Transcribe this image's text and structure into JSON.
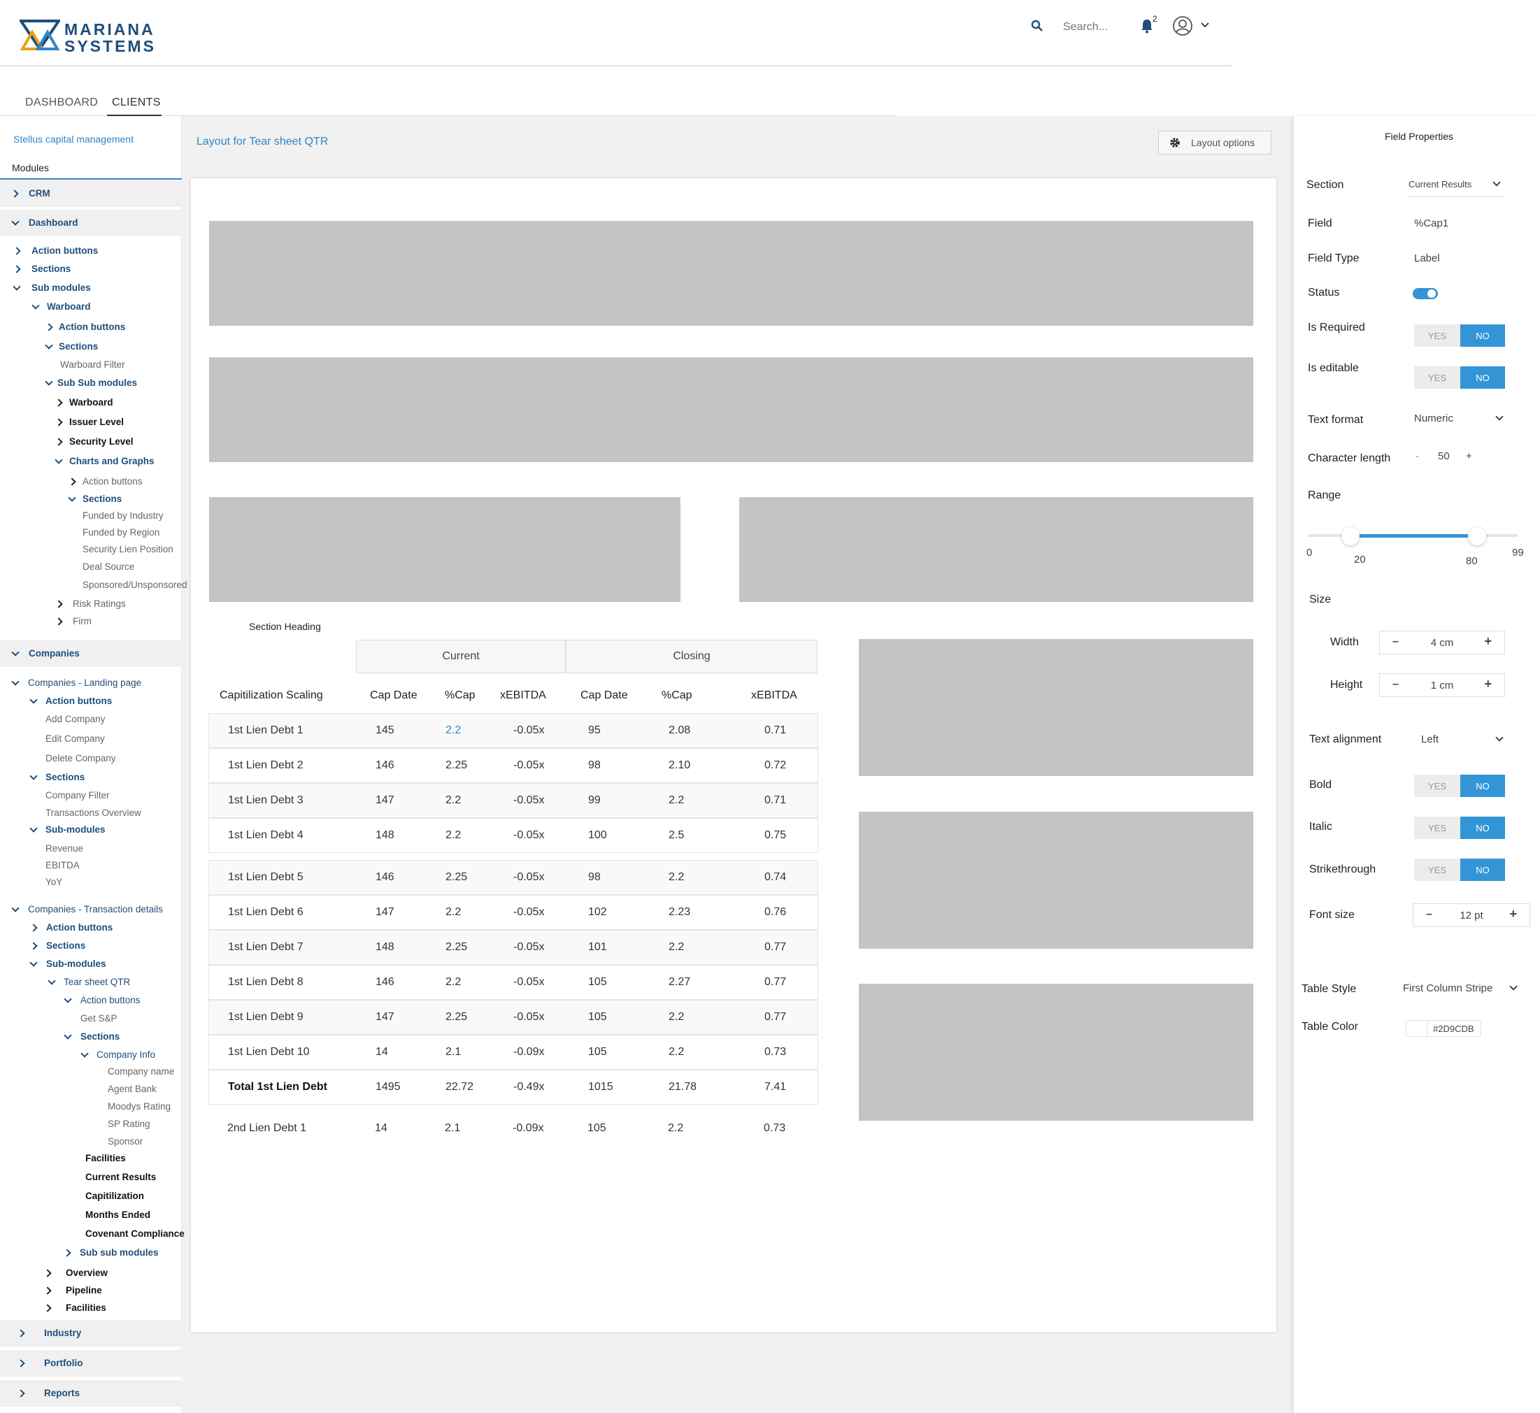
{
  "app": {
    "logo_line1": "MARIANA",
    "logo_line2": "SYSTEMS"
  },
  "header": {
    "search_placeholder": "Search...",
    "notification_count": "2"
  },
  "tabs": [
    {
      "label": "DASHBOARD"
    },
    {
      "label": "CLIENTS"
    }
  ],
  "sidebar": {
    "client": "Stellus capital management",
    "modules_label": "Modules",
    "modules": [
      {
        "label": "CRM"
      },
      {
        "label": "Dashboard"
      },
      {
        "label": "Companies"
      },
      {
        "label": "Industry"
      },
      {
        "label": "Portfolio"
      },
      {
        "label": "Reports"
      }
    ],
    "tree": {
      "dash_action_buttons": "Action buttons",
      "dash_sections": "Sections",
      "dash_sub_modules": "Sub modules",
      "warboard": "Warboard",
      "wb_action_buttons": "Action buttons",
      "wb_sections": "Sections",
      "warboard_filter": "Warboard Filter",
      "sub_sub_modules": "Sub Sub modules",
      "ssm_warboard": "Warboard",
      "issuer_level": "Issuer Level",
      "security_level": "Security Level",
      "charts_and_graphs": "Charts and Graphs",
      "cg_action_buttons": "Action buttons",
      "cg_sections": "Sections",
      "funded_by_industry": "Funded by Industry",
      "funded_by_region": "Funded by Region",
      "security_lien_position": "Security Lien Position",
      "deal_source": "Deal Source",
      "sponsored": "Sponsored/Unsponsored",
      "risk_ratings": "Risk Ratings",
      "firm": "Firm",
      "companies_landing": "Companies - Landing page",
      "cl_action_buttons": "Action buttons",
      "add_company": "Add Company",
      "edit_company": "Edit Company",
      "delete_company": "Delete Company",
      "cl_sections": "Sections",
      "company_filter": "Company Filter",
      "transactions_overview": "Transactions Overview",
      "cl_sub_modules": "Sub-modules",
      "revenue": "Revenue",
      "ebitda": "EBITDA",
      "yoy": "YoY",
      "companies_transaction": "Companies - Transaction details",
      "ct_action_buttons": "Action buttons",
      "ct_sections": "Sections",
      "ct_sub_modules": "Sub-modules",
      "tear_sheet_qtr": "Tear sheet QTR",
      "ts_action_buttons": "Action buttons",
      "get_sp": "Get S&P",
      "ts_sections": "Sections",
      "company_info": "Company Info",
      "company_name": "Company name",
      "agent_bank": "Agent Bank",
      "moodys_rating": "Moodys Rating",
      "sp_rating": "SP Rating",
      "sponsor": "Sponsor",
      "facilities": "Facilities",
      "current_results": "Current Results",
      "capitilization": "Capitilization",
      "months_ended": "Months Ended",
      "covenant_compliance": "Covenant Compliance",
      "sub_sub_modules2": "Sub sub modules",
      "overview": "Overview",
      "pipeline": "Pipeline",
      "facilities2": "Facilities"
    }
  },
  "main": {
    "title": "Layout for Tear sheet QTR",
    "layout_options": "Layout options",
    "section_heading": "Section Heading"
  },
  "table": {
    "groups": [
      "Current",
      "Closing"
    ],
    "headers": [
      "Capitilization Scaling",
      "Cap Date",
      "%Cap",
      "xEBITDA",
      "Cap Date",
      "%Cap",
      "xEBITDA"
    ],
    "rows": [
      [
        "1st Lien Debt 1",
        "145",
        "2.2",
        "-0.05x",
        "95",
        "2.08",
        "0.71"
      ],
      [
        "1st Lien Debt 2",
        "146",
        "2.25",
        "-0.05x",
        "98",
        "2.10",
        "0.72"
      ],
      [
        "1st Lien Debt 3",
        "147",
        "2.2",
        "-0.05x",
        "99",
        "2.2",
        "0.71"
      ],
      [
        "1st Lien Debt 4",
        "148",
        "2.2",
        "-0.05x",
        "100",
        "2.5",
        "0.75"
      ],
      [
        "1st Lien Debt 5",
        "146",
        "2.25",
        "-0.05x",
        "98",
        "2.2",
        "0.74"
      ],
      [
        "1st Lien Debt 6",
        "147",
        "2.2",
        "-0.05x",
        "102",
        "2.23",
        "0.76"
      ],
      [
        "1st Lien Debt 7",
        "148",
        "2.25",
        "-0.05x",
        "101",
        "2.2",
        "0.77"
      ],
      [
        "1st Lien Debt 8",
        "146",
        "2.2",
        "-0.05x",
        "105",
        "2.27",
        "0.77"
      ],
      [
        "1st Lien Debt 9",
        "147",
        "2.25",
        "-0.05x",
        "105",
        "2.2",
        "0.77"
      ],
      [
        "1st Lien Debt 10",
        "14",
        "2.1",
        "-0.09x",
        "105",
        "2.2",
        "0.73"
      ],
      [
        "Total 1st Lien Debt",
        "1495",
        "22.72",
        "-0.49x",
        "1015",
        "21.78",
        "7.41"
      ],
      [
        "2nd Lien Debt 1",
        "14",
        "2.1",
        "-0.09x",
        "105",
        "2.2",
        "0.73"
      ]
    ]
  },
  "properties": {
    "title": "Field Properties",
    "section_label": "Section",
    "section_value": "Current Results",
    "field_label": "Field",
    "field_value": "%Cap1",
    "field_type_label": "Field Type",
    "field_type_value": "Label",
    "status_label": "Status",
    "status_on": true,
    "is_required_label": "Is Required",
    "is_editable_label": "Is editable",
    "yes": "YES",
    "no": "NO",
    "text_format_label": "Text format",
    "text_format_value": "Numeric",
    "char_length_label": "Character length",
    "char_minus": "-",
    "char_value": "50",
    "char_plus": "+",
    "range_label": "Range",
    "range_min": "0",
    "range_low": "20",
    "range_high": "80",
    "range_max": "99",
    "size_label": "Size",
    "width_label": "Width",
    "width_value": "4 cm",
    "height_label": "Height",
    "height_value": "1 cm",
    "text_alignment_label": "Text alignment",
    "text_alignment_value": "Left",
    "bold_label": "Bold",
    "italic_label": "Italic",
    "strikethrough_label": "Strikethrough",
    "font_size_label": "Font size",
    "font_size_value": "12 pt",
    "table_style_label": "Table Style",
    "table_style_value": "First Column Stripe",
    "table_color_label": "Table Color",
    "table_color_value": "#2D9CDB"
  },
  "colors": {
    "accent": "#3395D6",
    "brand_navy": "#1F4E79",
    "link_blue": "#2E86C8",
    "placeholder_gray": "#C4C4C4"
  }
}
